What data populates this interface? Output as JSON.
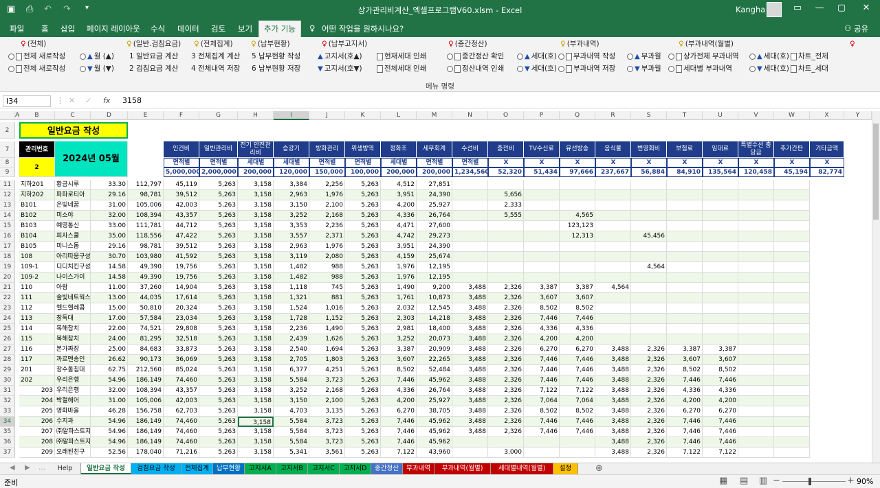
{
  "window": {
    "title": "상가관리비계산_엑셀프로그램V60.xlsm  -  Excel",
    "user": "Kangha"
  },
  "tabs": [
    "파일",
    "홈",
    "삽입",
    "페이지 레이아웃",
    "수식",
    "데이터",
    "검토",
    "보기",
    "추가 기능",
    "어떤 작업을 원하시나요?",
    "공유"
  ],
  "ribbon": {
    "groups": [
      "(전체)",
      "(일반.검침요금)",
      "(전체집계)",
      "(납부현황)",
      "(납부고지서)",
      "(중간정산)",
      "(부과내역)",
      "(부과내역(월별)"
    ],
    "row1": [
      "전체 새로작성",
      "월 (▲)",
      "1 일반요금 계산",
      "3 전체집계 계산",
      "5 납부현황 작성",
      "고지서(호▲)",
      "현재세대 인쇄",
      "중간정산 확인",
      "세대(호)",
      "부과내역 작성",
      "부과월",
      "상가전체 부과내역",
      "세대(호)",
      "차트_전체"
    ],
    "row2": [
      "전체 새로작성",
      "월 (▼)",
      "2 검침요금 계산",
      "4 전체내역 저장",
      "6 납부현황 저장",
      "고지서(호▼)",
      "전체세대 인쇄",
      "정산내역 인쇄",
      "세대(호)",
      "부과내역 저장",
      "부과월",
      "세대별 부과내역",
      "세대(호)",
      "차트_세대"
    ],
    "caption": "메뉴 명령"
  },
  "formula": {
    "cell": "I34",
    "fx": "fx",
    "value": "3158"
  },
  "columns": [
    "A",
    "B",
    "C",
    "D",
    "E",
    "F",
    "G",
    "H",
    "I",
    "J",
    "K",
    "L",
    "M",
    "N",
    "O",
    "P",
    "Q",
    "R",
    "S",
    "T",
    "U",
    "V",
    "W",
    "X",
    "Y",
    "Z"
  ],
  "sheet": {
    "title": "일반요금 작성",
    "mgmt_label": "관리번호",
    "mgmt_no": "2",
    "period": "2024년 05월",
    "headers": [
      "인건비",
      "일반관리비",
      "전기 안전관리비",
      "승강기",
      "방화관리",
      "위생방역",
      "정화조",
      "세무회계",
      "수선비",
      "중전비",
      "TV수신료",
      "유선방송",
      "음식물",
      "번영회비",
      "보험료",
      "임대료",
      "특별수선 충당금",
      "추가간판",
      "기타금액"
    ],
    "basis": [
      "면적별",
      "면적별",
      "세대별",
      "세대별",
      "면적별",
      "면적별",
      "세대별",
      "면적별",
      "면적별",
      "X",
      "X",
      "X",
      "X",
      "X",
      "X",
      "X",
      "X",
      "X",
      "X"
    ],
    "totals": [
      "5,000,000",
      "2,000,000",
      "200,000",
      "120,000",
      "150,000",
      "100,000",
      "200,000",
      "200,000",
      "1,234,560",
      "52,320",
      "51,434",
      "97,666",
      "237,667",
      "56,884",
      "84,910",
      "135,564",
      "120,458",
      "45,194",
      "82,774"
    ],
    "rows": [
      [
        "지하201",
        "황금시루",
        "33.30",
        "112,797",
        "45,119",
        "5,263",
        "3,158",
        "3,384",
        "2,256",
        "5,263",
        "4,512",
        "27,851",
        "",
        "",
        "",
        "",
        "",
        "",
        "",
        "",
        ""
      ],
      [
        "지하202",
        "파파로티아",
        "29.16",
        "98,781",
        "39,512",
        "5,263",
        "3,158",
        "2,963",
        "1,976",
        "5,263",
        "3,951",
        "24,390",
        "",
        "5,656",
        "",
        "",
        "",
        "",
        "",
        "",
        ""
      ],
      [
        "B101",
        "은빛네꿈",
        "31.00",
        "105,006",
        "42,003",
        "5,263",
        "3,158",
        "3,150",
        "2,100",
        "5,263",
        "4,200",
        "25,927",
        "",
        "2,333",
        "",
        "",
        "",
        "",
        "",
        "",
        ""
      ],
      [
        "B102",
        "미소야",
        "32.00",
        "108,394",
        "43,357",
        "5,263",
        "3,158",
        "3,252",
        "2,168",
        "5,263",
        "4,336",
        "26,764",
        "",
        "5,555",
        "",
        "4,565",
        "",
        "",
        "",
        "",
        ""
      ],
      [
        "B103",
        "예영통신",
        "33.00",
        "111,781",
        "44,712",
        "5,263",
        "3,158",
        "3,353",
        "2,236",
        "5,263",
        "4,471",
        "27,600",
        "",
        "",
        "",
        "123,123",
        "",
        "",
        "",
        "",
        ""
      ],
      [
        "B104",
        "피자스쿨",
        "35.00",
        "118,556",
        "47,422",
        "5,263",
        "3,158",
        "3,557",
        "2,371",
        "5,263",
        "4,742",
        "29,273",
        "",
        "",
        "",
        "12,313",
        "",
        "45,456",
        "",
        "",
        ""
      ],
      [
        "B105",
        "미니스톱",
        "29.16",
        "98,781",
        "39,512",
        "5,263",
        "3,158",
        "2,963",
        "1,976",
        "5,263",
        "3,951",
        "24,390",
        "",
        "",
        "",
        "",
        "",
        "",
        "",
        "",
        ""
      ],
      [
        "108",
        "아리따움구성",
        "30.70",
        "103,980",
        "41,592",
        "5,263",
        "3,158",
        "3,119",
        "2,080",
        "5,263",
        "4,159",
        "25,674",
        "",
        "",
        "",
        "",
        "",
        "",
        "",
        "",
        ""
      ],
      [
        "109-1",
        "디디치킨구성",
        "14.58",
        "49,390",
        "19,756",
        "5,263",
        "3,158",
        "1,482",
        "988",
        "5,263",
        "1,976",
        "12,195",
        "",
        "",
        "",
        "",
        "",
        "4,564",
        "",
        "",
        ""
      ],
      [
        "109-2",
        "나이스가이",
        "14.58",
        "49,390",
        "19,756",
        "5,263",
        "3,158",
        "1,482",
        "988",
        "5,263",
        "1,976",
        "12,195",
        "",
        "",
        "",
        "",
        "",
        "",
        "",
        "",
        ""
      ],
      [
        "110",
        "아람",
        "11.00",
        "37,260",
        "14,904",
        "5,263",
        "3,158",
        "1,118",
        "745",
        "5,263",
        "1,490",
        "9,200",
        "3,488",
        "2,326",
        "3,387",
        "3,387",
        "4,564",
        "",
        "",
        "",
        ""
      ],
      [
        "111",
        "솔빛네트웍스",
        "13.00",
        "44,035",
        "17,614",
        "5,263",
        "3,158",
        "1,321",
        "881",
        "5,263",
        "1,761",
        "10,873",
        "3,488",
        "2,326",
        "3,607",
        "3,607",
        "",
        "",
        "",
        "",
        ""
      ],
      [
        "112",
        "헬드헬레콤",
        "15.00",
        "50,810",
        "20,324",
        "5,263",
        "3,158",
        "1,524",
        "1,016",
        "5,263",
        "2,032",
        "12,545",
        "3,488",
        "2,326",
        "8,502",
        "8,502",
        "",
        "",
        "",
        "",
        ""
      ],
      [
        "113",
        "창독대",
        "17.00",
        "57,584",
        "23,034",
        "5,263",
        "3,158",
        "1,728",
        "1,152",
        "5,263",
        "2,303",
        "14,218",
        "3,488",
        "2,326",
        "7,446",
        "7,446",
        "",
        "",
        "",
        "",
        ""
      ],
      [
        "114",
        "복해참치",
        "22.00",
        "74,521",
        "29,808",
        "5,263",
        "3,158",
        "2,236",
        "1,490",
        "5,263",
        "2,981",
        "18,400",
        "3,488",
        "2,326",
        "4,336",
        "4,336",
        "",
        "",
        "",
        "",
        ""
      ],
      [
        "115",
        "복해참치",
        "24.00",
        "81,295",
        "32,518",
        "5,263",
        "3,158",
        "2,439",
        "1,626",
        "5,263",
        "3,252",
        "20,073",
        "3,488",
        "2,326",
        "4,200",
        "4,200",
        "",
        "",
        "",
        "",
        ""
      ],
      [
        "116",
        "본가짜장",
        "25.00",
        "84,683",
        "33,873",
        "5,263",
        "3,158",
        "2,540",
        "1,694",
        "5,263",
        "3,387",
        "20,909",
        "3,488",
        "2,326",
        "6,270",
        "6,270",
        "3,488",
        "2,326",
        "3,387",
        "3,387",
        ""
      ],
      [
        "117",
        "까르멘송인",
        "26.62",
        "90,173",
        "36,069",
        "5,263",
        "3,158",
        "2,705",
        "1,803",
        "5,263",
        "3,607",
        "22,265",
        "3,488",
        "2,326",
        "7,446",
        "7,446",
        "3,488",
        "2,326",
        "3,607",
        "3,607",
        ""
      ],
      [
        "201",
        "장수돌침대",
        "62.75",
        "212,560",
        "85,024",
        "5,263",
        "3,158",
        "6,377",
        "4,251",
        "5,263",
        "8,502",
        "52,484",
        "3,488",
        "2,326",
        "7,446",
        "7,446",
        "3,488",
        "2,326",
        "8,502",
        "8,502",
        ""
      ],
      [
        "202",
        "우리은행",
        "54.96",
        "186,149",
        "74,460",
        "5,263",
        "3,158",
        "5,584",
        "3,723",
        "5,263",
        "7,446",
        "45,962",
        "3,488",
        "2,326",
        "7,446",
        "7,446",
        "3,488",
        "2,326",
        "7,446",
        "7,446",
        ""
      ],
      [
        "203",
        "우리은행",
        "32.00",
        "108,394",
        "43,357",
        "5,263",
        "3,158",
        "3,252",
        "2,168",
        "5,263",
        "4,336",
        "26,764",
        "3,488",
        "2,326",
        "7,122",
        "7,122",
        "3,488",
        "2,326",
        "4,336",
        "4,336",
        ""
      ],
      [
        "204",
        "박철헤어",
        "31.00",
        "105,006",
        "42,003",
        "5,263",
        "3,158",
        "3,150",
        "2,100",
        "5,263",
        "4,200",
        "25,927",
        "3,488",
        "2,326",
        "7,064",
        "7,064",
        "3,488",
        "2,326",
        "4,200",
        "4,200",
        ""
      ],
      [
        "205",
        "영화마을",
        "46.28",
        "156,758",
        "62,703",
        "5,263",
        "3,158",
        "4,703",
        "3,135",
        "5,263",
        "6,270",
        "38,705",
        "3,488",
        "2,326",
        "8,502",
        "8,502",
        "3,488",
        "2,326",
        "6,270",
        "6,270",
        ""
      ],
      [
        "206",
        "수지과",
        "54.96",
        "186,149",
        "74,460",
        "5,263",
        "3,158",
        "5,584",
        "3,723",
        "5,263",
        "7,446",
        "45,962",
        "3,488",
        "2,326",
        "7,446",
        "7,446",
        "3,488",
        "2,326",
        "7,446",
        "7,446",
        ""
      ],
      [
        "207",
        "㈜알파스트자",
        "54.96",
        "186,149",
        "74,460",
        "5,263",
        "3,158",
        "5,584",
        "3,723",
        "5,263",
        "7,446",
        "45,962",
        "3,488",
        "2,326",
        "7,446",
        "7,446",
        "3,488",
        "2,326",
        "7,446",
        "7,446",
        ""
      ],
      [
        "208",
        "㈜알파스트자",
        "54.96",
        "186,149",
        "74,460",
        "5,263",
        "3,158",
        "5,584",
        "3,723",
        "5,263",
        "7,446",
        "45,962",
        "",
        "",
        "",
        "",
        "3,488",
        "2,326",
        "7,446",
        "7,446",
        ""
      ],
      [
        "209",
        "오래된친구",
        "52.56",
        "178,040",
        "71,216",
        "5,263",
        "3,158",
        "5,341",
        "3,561",
        "5,263",
        "7,122",
        "43,960",
        "",
        "3,000",
        "",
        "",
        "3,488",
        "2,326",
        "7,122",
        "7,122",
        ""
      ]
    ]
  },
  "sheet_tabs": [
    {
      "label": "Help",
      "color": "#f0f0f0",
      "text": "#222"
    },
    {
      "label": "일반요금 작성",
      "color": "#ffffff",
      "text": "#217346"
    },
    {
      "label": "검침요금 작성",
      "color": "#00b0f0",
      "text": "#000"
    },
    {
      "label": "전체집계",
      "color": "#00b0f0",
      "text": "#000"
    },
    {
      "label": "납부현황",
      "color": "#0070c0",
      "text": "#fff"
    },
    {
      "label": "고지서A",
      "color": "#00b050",
      "text": "#000"
    },
    {
      "label": "고지서B",
      "color": "#00b050",
      "text": "#000"
    },
    {
      "label": "고지서C",
      "color": "#00b050",
      "text": "#000"
    },
    {
      "label": "고지서D",
      "color": "#00b050",
      "text": "#000"
    },
    {
      "label": "중간정산",
      "color": "#4472c4",
      "text": "#fff"
    },
    {
      "label": "부과내역",
      "color": "#c00000",
      "text": "#fff"
    },
    {
      "label": "부과내역(월별)",
      "color": "#c00000",
      "text": "#fff"
    },
    {
      "label": "세대별내역(월별)",
      "color": "#c00000",
      "text": "#fff"
    },
    {
      "label": "설정",
      "color": "#ffc000",
      "text": "#000"
    }
  ],
  "status": {
    "ready": "준비",
    "zoom": "90%"
  },
  "colors": {
    "excel_green": "#217346",
    "header_blue": "#1f3d8a",
    "title_yellow": "#ffff00"
  }
}
